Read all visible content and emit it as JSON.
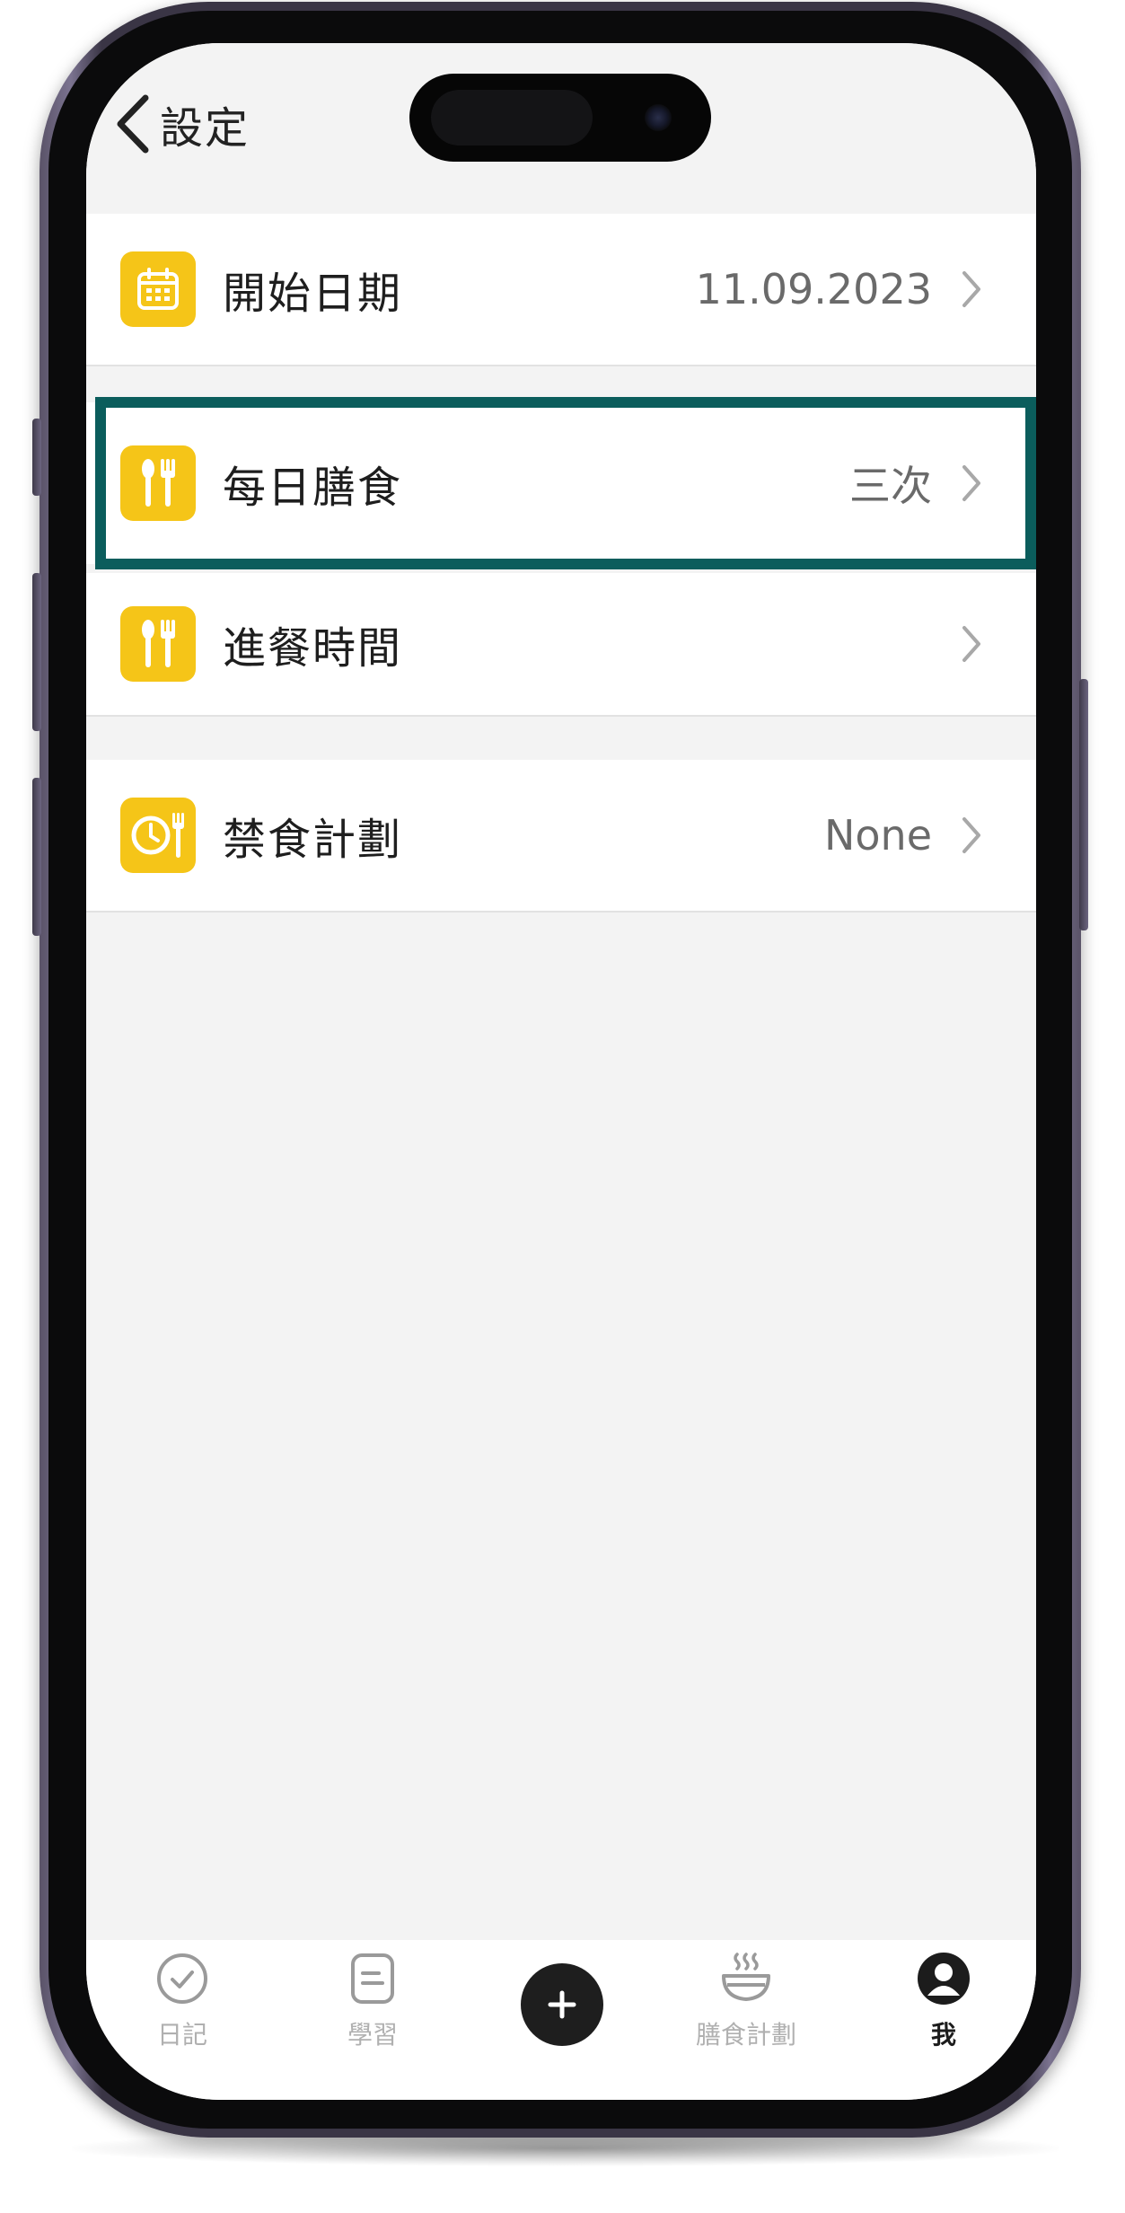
{
  "header": {
    "back_label": "設定"
  },
  "settings": {
    "start_date": {
      "label": "開始日期",
      "value": "11.09.2023"
    },
    "daily_meals": {
      "label": "每日膳食",
      "value": "三次"
    },
    "meal_times": {
      "label": "進餐時間",
      "value": ""
    },
    "fasting_plan": {
      "label": "禁食計劃",
      "value": "None"
    }
  },
  "tabs": [
    {
      "label": "日記",
      "icon": "check-circle-icon",
      "active": false
    },
    {
      "label": "學習",
      "icon": "document-icon",
      "active": false
    },
    {
      "label": "",
      "icon": "plus-icon",
      "active": false
    },
    {
      "label": "膳食計劃",
      "icon": "steaming-bowl-icon",
      "active": false
    },
    {
      "label": "我",
      "icon": "user-icon",
      "active": true
    }
  ],
  "colors": {
    "accent_icon_bg": "#f5c518",
    "highlight_border": "#0b5d5c",
    "screen_bg": "#f3f3f3"
  }
}
